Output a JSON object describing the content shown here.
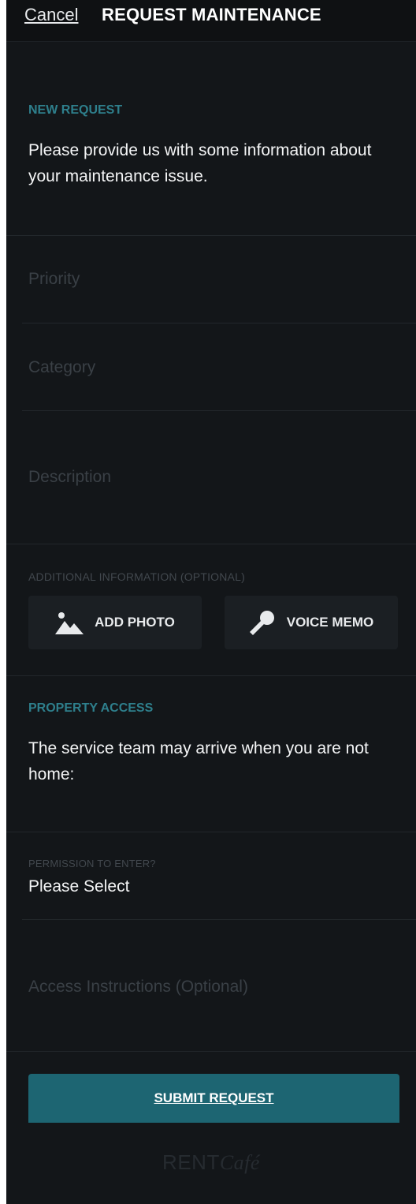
{
  "header": {
    "cancel_label": "Cancel",
    "title": "REQUEST MAINTENANCE"
  },
  "new_request": {
    "heading": "NEW REQUEST",
    "intro": "Please provide us with some information about your maintenance issue."
  },
  "form": {
    "priority_placeholder": "Priority",
    "category_placeholder": "Category",
    "description_placeholder": "Description"
  },
  "additional_info": {
    "label": "ADDITIONAL INFORMATION (OPTIONAL)",
    "add_photo_label": "ADD PHOTO",
    "add_photo_icon": "photo-icon",
    "voice_memo_label": "VOICE MEMO",
    "voice_memo_icon": "microphone-icon"
  },
  "property_access": {
    "heading": "PROPERTY ACCESS",
    "intro": "The service team may arrive when you are not home:",
    "permission_label": "PERMISSION TO ENTER?",
    "permission_value": "Please Select",
    "access_instructions_placeholder": "Access Instructions (Optional)"
  },
  "submit_label": "SUBMIT REQUEST",
  "brand": {
    "rent": "RENT",
    "cafe": "Café"
  },
  "colors": {
    "background": "#131619",
    "accent": "#2e7f8c",
    "submit_button": "#1d6572"
  }
}
